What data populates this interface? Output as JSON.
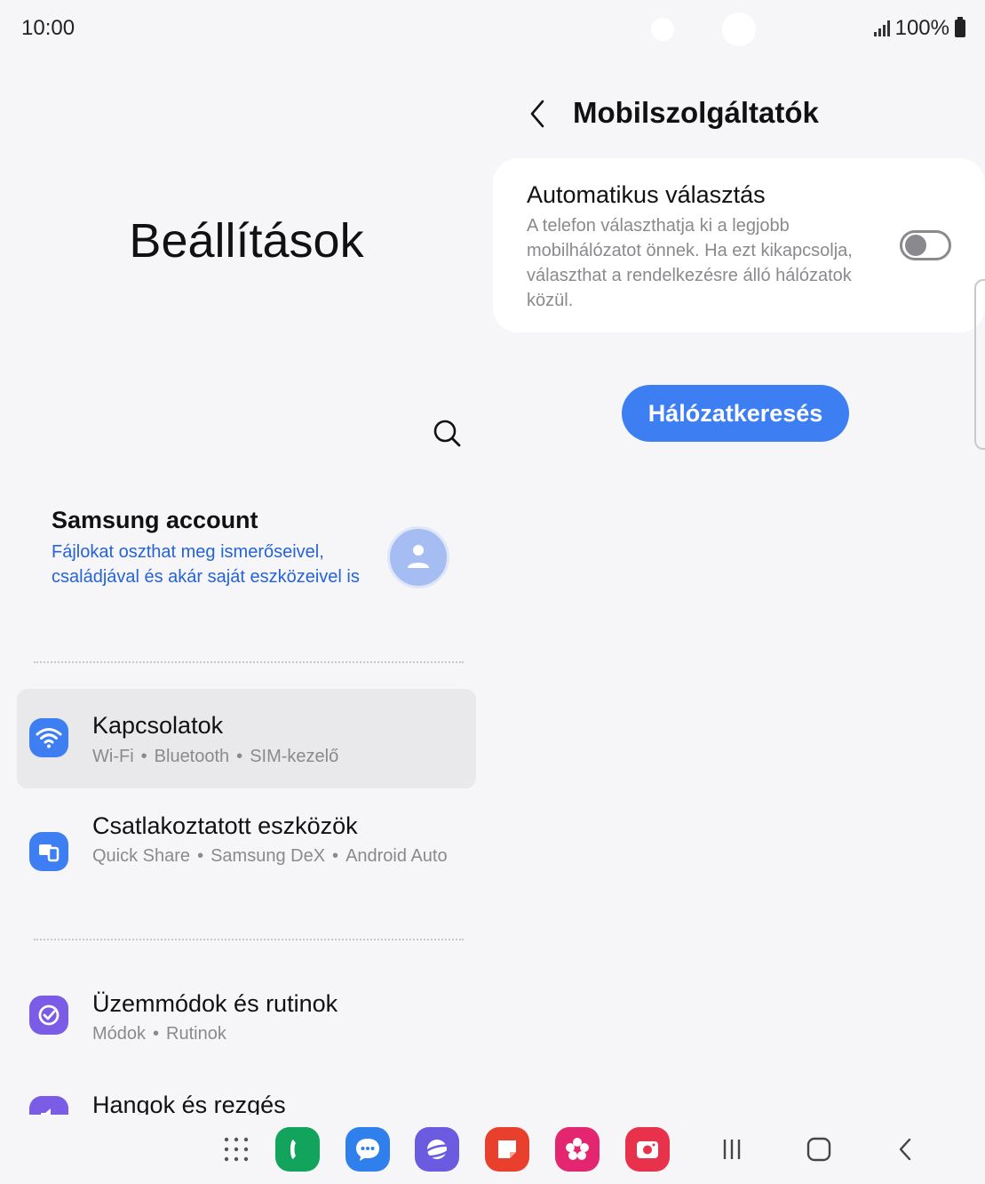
{
  "status": {
    "time": "10:00",
    "battery": "100%"
  },
  "left": {
    "title": "Beállítások",
    "account": {
      "title": "Samsung account",
      "description": "Fájlokat oszthat meg ismerőseivel, családjával és akár saját eszközeivel is"
    },
    "items": [
      {
        "title": "Kapcsolatok",
        "sub": [
          "Wi-Fi",
          "Bluetooth",
          "SIM-kezelő"
        ],
        "color": "#3d7ff2",
        "icon": "wifi-icon",
        "selected": true
      },
      {
        "title": "Csatlakoztatott eszközök",
        "sub": [
          "Quick Share",
          "Samsung DeX",
          "Android Auto"
        ],
        "color": "#3d7ff2",
        "icon": "connected-devices-icon"
      },
      {
        "title": "Üzemmódok és rutinok",
        "sub": [
          "Módok",
          "Rutinok"
        ],
        "color": "#7b5ce6",
        "icon": "modes-routines-icon"
      },
      {
        "title": "Hangok és rezgés",
        "sub": [],
        "color": "#7b5ce6",
        "icon": "sound-icon"
      }
    ]
  },
  "right": {
    "title": "Mobilszolgáltatók",
    "auto": {
      "title": "Automatikus választás",
      "description": "A telefon választhatja ki a legjobb mobilhálózatot önnek. Ha ezt kikapcsolja, választhat a rendelkezésre álló hálózatok közül.",
      "enabled": false
    },
    "scan_label": "Hálózatkeresés"
  },
  "dock": {
    "apps": [
      {
        "icon": "phone-icon",
        "color": "#12a45c"
      },
      {
        "icon": "messages-icon",
        "color": "#2f80ed"
      },
      {
        "icon": "internet-icon",
        "color": "#6a5be0"
      },
      {
        "icon": "notes-icon",
        "color": "#e8402d"
      },
      {
        "icon": "gallery-icon",
        "color": "#e3266f"
      },
      {
        "icon": "camera-icon",
        "color": "#e8314a"
      }
    ]
  }
}
